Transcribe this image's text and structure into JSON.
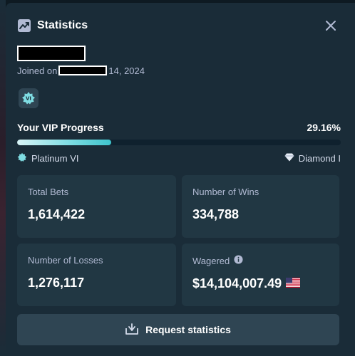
{
  "header": {
    "title": "Statistics",
    "title_icon": "trending-chart-icon",
    "close_icon": "close-icon"
  },
  "profile": {
    "joined_prefix": "Joined on",
    "joined_suffix": "14, 2024"
  },
  "vip": {
    "label": "Your VIP Progress",
    "percent_text": "29.16%",
    "progress_fraction": 0.2916,
    "current_tier": "Platinum VI",
    "next_tier": "Diamond I",
    "badge_glyph": "VI"
  },
  "stats": [
    {
      "label": "Total Bets",
      "value": "1,614,422"
    },
    {
      "label": "Number of Wins",
      "value": "334,788"
    },
    {
      "label": "Number of Losses",
      "value": "1,276,117"
    },
    {
      "label": "Wagered",
      "value": "$14,104,007.49",
      "info_icon": "info-icon",
      "currency_icon": "us-flag-icon"
    }
  ],
  "request_button": {
    "label": "Request statistics",
    "icon": "download-tray-icon"
  },
  "colors": {
    "modal_bg": "#1a2c38",
    "card_bg": "#213743",
    "muted_text": "#b1bad3",
    "progress_accent": "#3ec4cc"
  }
}
